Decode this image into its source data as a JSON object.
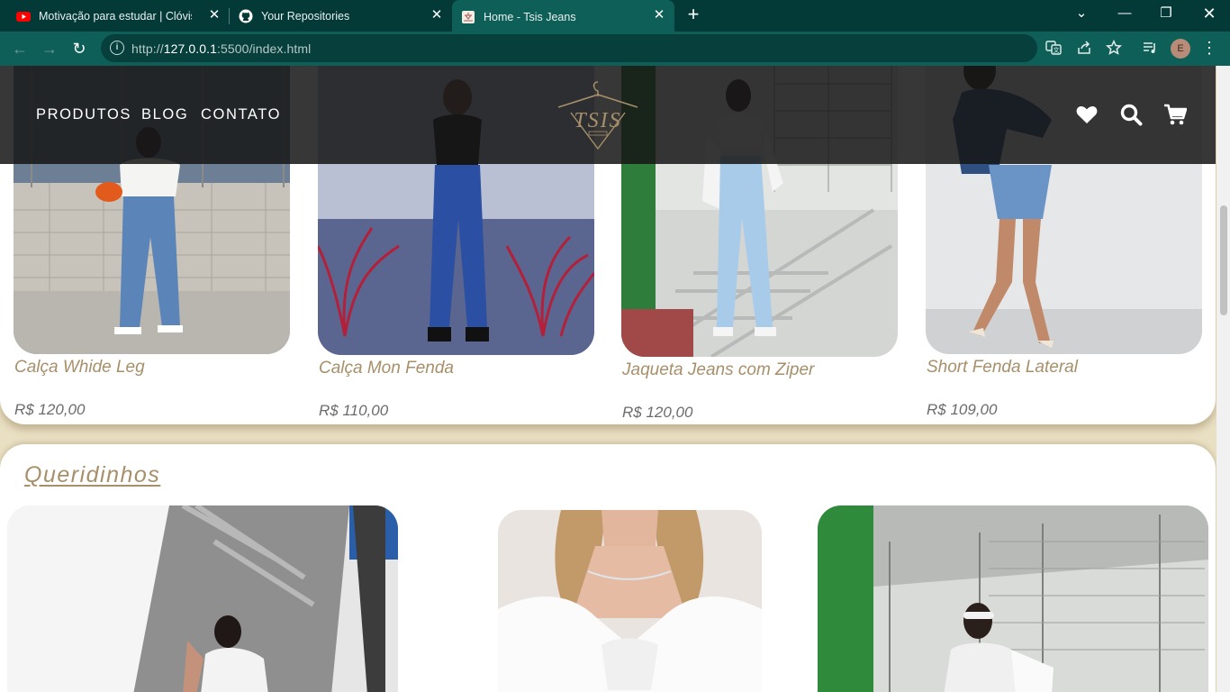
{
  "browser": {
    "tabs": [
      {
        "title": "Motivação para estudar | Clóvis de",
        "favicon": "youtube-icon"
      },
      {
        "title": "Your Repositories",
        "favicon": "github-icon"
      },
      {
        "title": "Home - Tsis Jeans",
        "favicon": "tsis-icon",
        "active": true
      }
    ],
    "url_prefix": "http://",
    "url_host": "127.0.0.1",
    "url_rest": ":5500/index.html",
    "profile_initial": "E",
    "accent": "#0f5f59"
  },
  "site": {
    "nav": [
      {
        "label": "PRODUTOS"
      },
      {
        "label": "BLOG"
      },
      {
        "label": "CONTATO"
      }
    ],
    "logo_text": "TSIS",
    "header_icons": [
      "heart-icon",
      "search-icon",
      "cart-icon"
    ],
    "brand_color": "#a78f6a"
  },
  "products": [
    {
      "name": "Calça Whide Leg",
      "price": "R$ 120,00"
    },
    {
      "name": "Calça Mon Fenda",
      "price": "R$ 110,00"
    },
    {
      "name": "Jaqueta Jeans com Ziper",
      "price": "R$ 120,00"
    },
    {
      "name": "Short Fenda Lateral",
      "price": "R$ 109,00"
    }
  ],
  "favorites": {
    "title": "Queridinhos"
  }
}
